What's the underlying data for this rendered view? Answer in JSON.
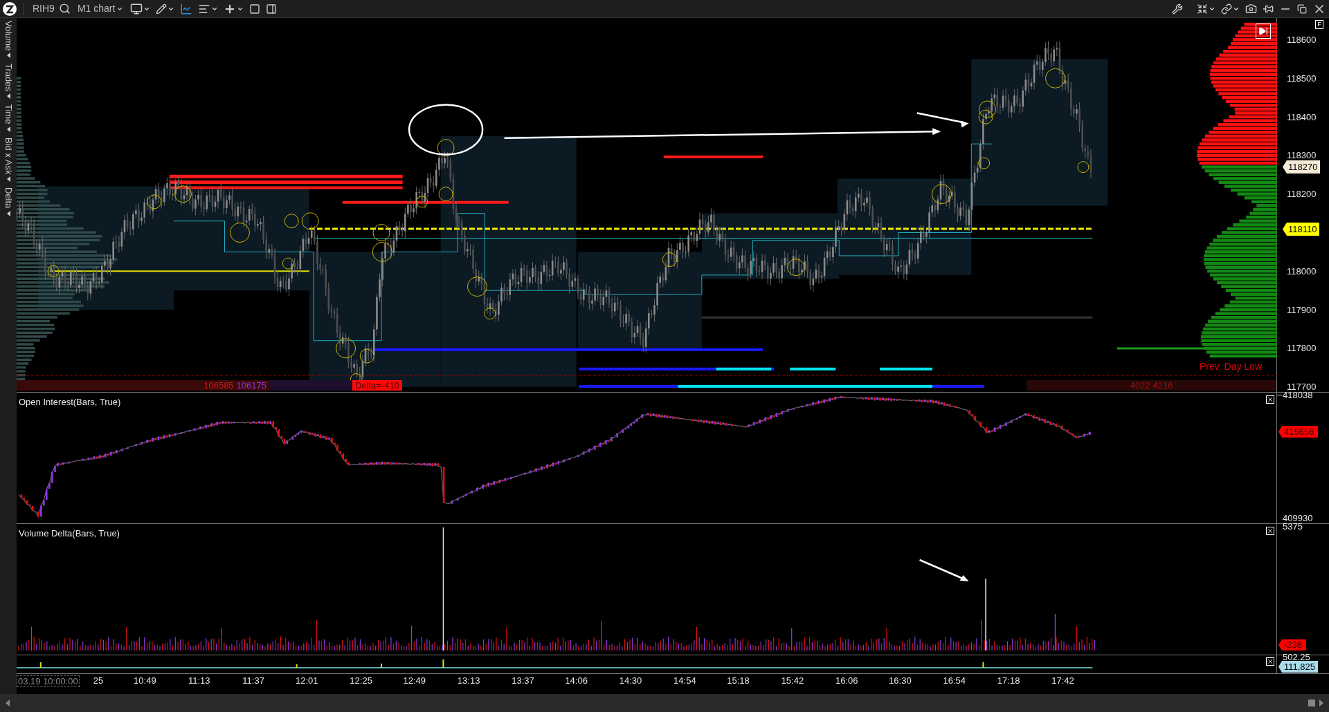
{
  "toolbar": {
    "symbol": "RIH9",
    "chart_menu": "M1 chart"
  },
  "left_tabs": [
    "Volume",
    "Trades",
    "Time",
    "Bid x Ask",
    "Delta"
  ],
  "main_chart": {
    "prev_day_low_label": "Prev. Day Low",
    "ask_total": "106585",
    "bid_total": "106175",
    "delta_label": "Delta=-410",
    "right_totals": "4022 4216"
  },
  "price_axis": {
    "ticks": [
      "118600",
      "118500",
      "118400",
      "118300",
      "118200",
      "118000",
      "117900",
      "117800",
      "117700"
    ],
    "last_price": "118270",
    "level_price": "118110",
    "f_button": "F"
  },
  "open_interest": {
    "title": "Open Interest(Bars, True)",
    "axis_max": "418038",
    "axis_min": "409930",
    "current": "415656"
  },
  "volume_delta": {
    "title": "Volume Delta(Bars, True)",
    "axis_max": "5375",
    "current": "-238"
  },
  "mini_panel": {
    "axis_max": "502.25",
    "current": "111,825"
  },
  "time_axis": {
    "start": "03.19 10:00:00",
    "labels": [
      "25",
      "10:49",
      "11:13",
      "11:37",
      "12:01",
      "12:25",
      "12:49",
      "13:13",
      "13:37",
      "14:06",
      "14:30",
      "14:54",
      "15:18",
      "15:42",
      "16:06",
      "16:30",
      "16:54",
      "17:18",
      "17:42"
    ]
  }
}
